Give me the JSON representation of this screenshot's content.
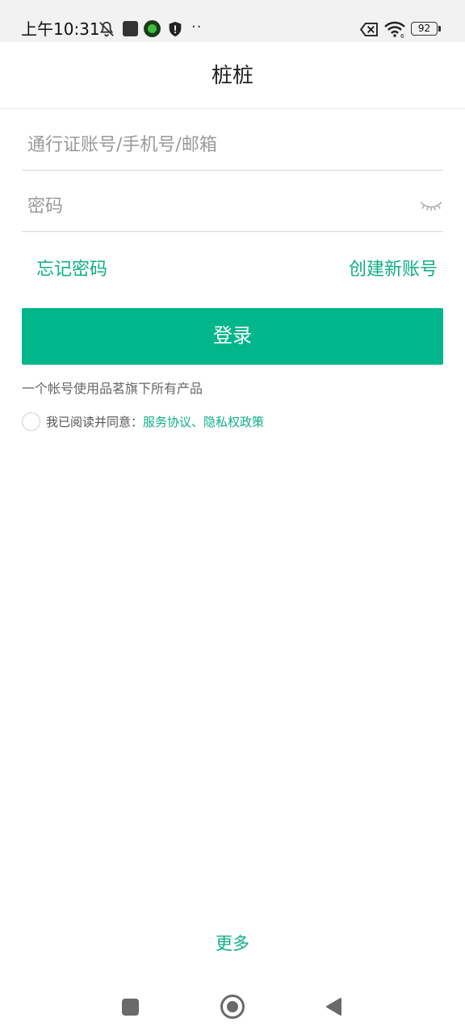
{
  "status_bar": {
    "time": "上午10:31",
    "battery": "92",
    "icons": [
      "bell-off-icon",
      "app-square-icon",
      "app-round-icon",
      "shield-icon",
      "more-dots-icon",
      "sim-off-icon",
      "wifi-icon",
      "battery-icon"
    ]
  },
  "header": {
    "title": "桩桩"
  },
  "form": {
    "account_placeholder": "通行证账号/手机号/邮箱",
    "password_placeholder": "密码",
    "forgot_label": "忘记密码",
    "register_label": "创建新账号",
    "login_label": "登录"
  },
  "hint": "一个帐号使用品茗旗下所有产品",
  "agreement": {
    "prefix": "我已阅读并同意：",
    "links": "服务协议、隐私权政策"
  },
  "more_label": "更多",
  "colors": {
    "accent": "#00b68a",
    "link": "#0fae86"
  }
}
